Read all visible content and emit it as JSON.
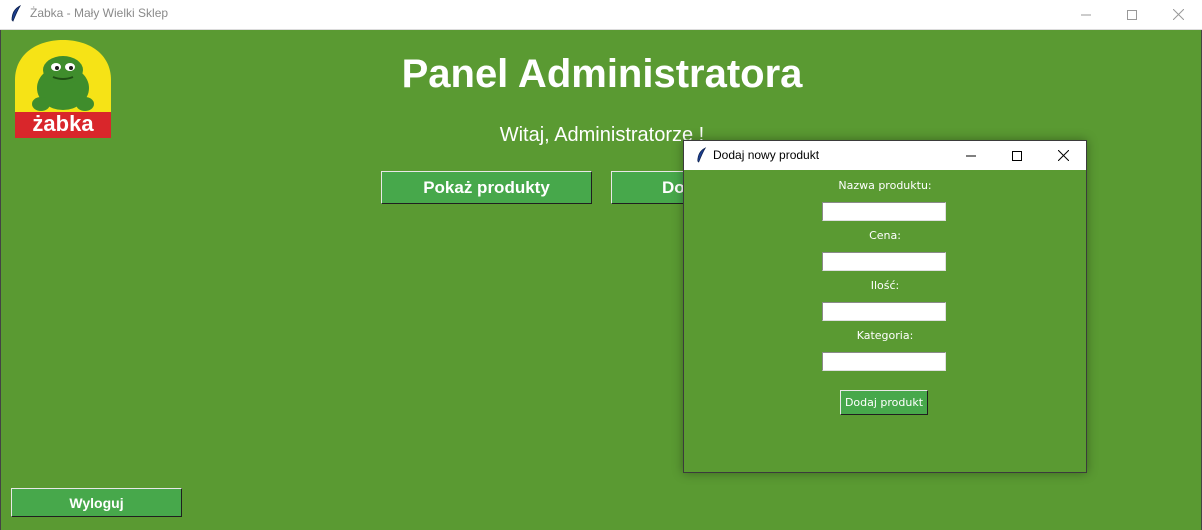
{
  "window": {
    "title": "Żabka - Mały Wielki Sklep",
    "controls": [
      "minimize-icon",
      "maximize-icon",
      "close-icon"
    ]
  },
  "logo": {
    "text": "żabka",
    "colors": {
      "yellow": "#f6e316",
      "red": "#d9262b",
      "green": "#3f8d2c"
    }
  },
  "main": {
    "title": "Panel Administratora",
    "welcome": "Witaj, Administratorze !",
    "buttons": {
      "show_products": "Pokaż produkty",
      "add_product": "Dodaj produkt",
      "logout": "Wyloguj"
    }
  },
  "dialog": {
    "title": "Dodaj nowy produkt",
    "fields": [
      {
        "label": "Nazwa produktu:",
        "value": ""
      },
      {
        "label": "Cena:",
        "value": ""
      },
      {
        "label": "Ilość:",
        "value": ""
      },
      {
        "label": "Kategoria:",
        "value": ""
      }
    ],
    "submit": "Dodaj produkt"
  },
  "colors": {
    "background": "#5a9a32",
    "button": "#47a84b",
    "text": "#ffffff"
  }
}
